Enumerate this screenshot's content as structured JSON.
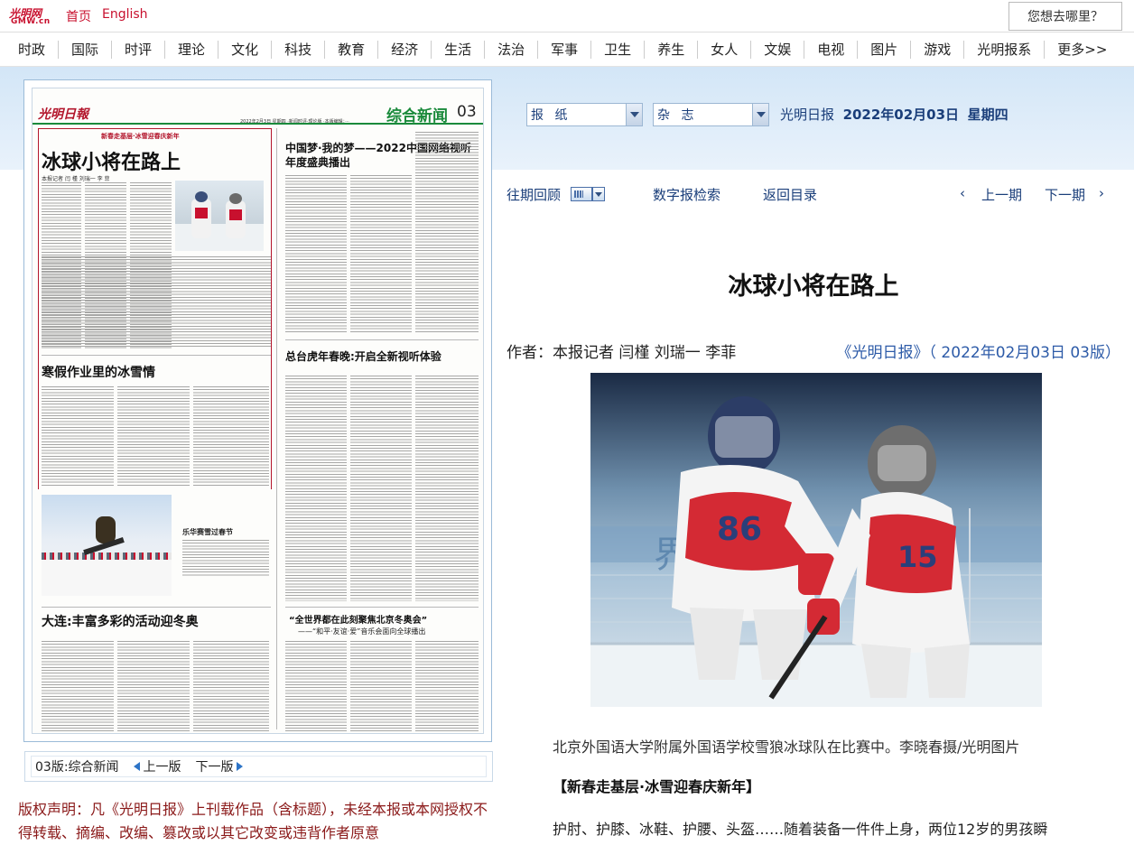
{
  "site": {
    "logo_text": "光明网",
    "logo_sub": "GMW.cn",
    "home_link": "首页",
    "english_link": "English",
    "search_prompt": "您想去哪里？"
  },
  "nav": [
    "时政",
    "国际",
    "时评",
    "理论",
    "文化",
    "科技",
    "教育",
    "经济",
    "生活",
    "法治",
    "军事",
    "卫生",
    "养生",
    "女人",
    "文娱",
    "电视",
    "图片",
    "游戏",
    "光明报系",
    "更多>>"
  ],
  "selectors": {
    "paper_label": "报 纸",
    "magazine_label": "杂 志"
  },
  "edition": {
    "paper_name": "光明日报",
    "date": "2022年02月03日",
    "weekday": "星期四"
  },
  "toolbar": {
    "history": "往期回顾",
    "search": "数字报检索",
    "back": "返回目录",
    "prev_prefix": "‹",
    "prev": "上一期",
    "next": "下一期",
    "next_suffix": "›"
  },
  "page_thumb": {
    "logo": "光明日報",
    "section": "综合新闻",
    "number": "03",
    "dateline": "2022年2月3日 星期四 ·新闻时评·理论版 ·本版编辑：···",
    "banner": "新春走基层·冰雪迎春庆新年",
    "headline_main": "冰球小将在路上",
    "byline_main": "本报记者 闫 槿 刘瑞一 李 菲",
    "headline_2": "中国梦·我的梦——2022中国网络视听年度盛典播出",
    "headline_3": "寒假作业里的冰雪情",
    "headline_4": "总台虎年春晚:开启全新视听体验",
    "headline_5": "大连:丰富多彩的活动迎冬奥",
    "headline_6": "“全世界都在此刻聚焦北京冬奥会”",
    "subhead_6": "——“和平·友谊·爱”音乐会面向全球播出",
    "photo_caption": "乐华赛雪过春节"
  },
  "page_footer": {
    "page_label": "03版:综合新闻",
    "prev_page": "上一版",
    "next_page": "下一版"
  },
  "copyright": "版权声明：凡《光明日报》上刊载作品（含标题），未经本报或本网授权不得转载、摘编、改编、篡改或以其它改变或违背作者原意",
  "article": {
    "title": "冰球小将在路上",
    "author": "作者：本报记者 闫槿 刘瑞一 李菲",
    "source": "《光明日报》（ 2022年02月03日 03版）",
    "caption": "北京外国语大学附属外国语学校雪狼冰球队在比赛中。李晓春摄/光明图片",
    "section_tag": "【新春走基层·冰雪迎春庆新年】",
    "lead": "护肘、护膝、冰鞋、护腰、头盔……随着装备一件件上身，两位12岁的男孩瞬",
    "jersey_left": "86",
    "jersey_right": "15",
    "jersey_thumb": "86"
  },
  "colors": {
    "brand_red": "#c8102e",
    "section_green": "#1a8a3b",
    "link_blue": "#2d5ba8",
    "nav_band": "#d3e6f7",
    "copyright_red": "#8b1a1a"
  }
}
